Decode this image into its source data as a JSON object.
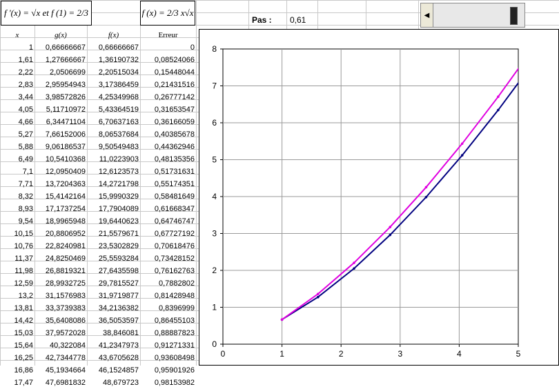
{
  "formulas": {
    "left": "f '(x) = √x  et  f (1) = 2/3",
    "right": "f (x) = 2/3 x√x"
  },
  "pas": {
    "label": "Pas :",
    "value": "0,61"
  },
  "table": {
    "headers": [
      "x",
      "g(x)",
      "f(x)",
      "Erreur"
    ],
    "rows": [
      [
        "1",
        "0,66666667",
        "0,66666667",
        "0"
      ],
      [
        "1,61",
        "1,27666667",
        "1,36190732",
        "0,08524066"
      ],
      [
        "2,22",
        "2,0506699",
        "2,20515034",
        "0,15448044"
      ],
      [
        "2,83",
        "2,95954943",
        "3,17386459",
        "0,21431516"
      ],
      [
        "3,44",
        "3,98572826",
        "4,25349968",
        "0,26777142"
      ],
      [
        "4,05",
        "5,11710972",
        "5,43364519",
        "0,31653547"
      ],
      [
        "4,66",
        "6,34471104",
        "6,70637163",
        "0,36166059"
      ],
      [
        "5,27",
        "7,66152006",
        "8,06537684",
        "0,40385678"
      ],
      [
        "5,88",
        "9,06186537",
        "9,50549483",
        "0,44362946"
      ],
      [
        "6,49",
        "10,5410368",
        "11,0223903",
        "0,48135356"
      ],
      [
        "7,1",
        "12,0950409",
        "12,6123573",
        "0,51731631"
      ],
      [
        "7,71",
        "13,7204363",
        "14,2721798",
        "0,55174351"
      ],
      [
        "8,32",
        "15,4142164",
        "15,9990329",
        "0,58481649"
      ],
      [
        "8,93",
        "17,1737254",
        "17,7904089",
        "0,61668347"
      ],
      [
        "9,54",
        "18,9965948",
        "19,6440623",
        "0,64746747"
      ],
      [
        "10,15",
        "20,8806952",
        "21,5579671",
        "0,67727192"
      ],
      [
        "10,76",
        "22,8240981",
        "23,5302829",
        "0,70618476"
      ],
      [
        "11,37",
        "24,8250469",
        "25,5593284",
        "0,73428152"
      ],
      [
        "11,98",
        "26,8819321",
        "27,6435598",
        "0,76162763"
      ],
      [
        "12,59",
        "28,9932725",
        "29,7815527",
        "0,7882802"
      ],
      [
        "13,2",
        "31,1576983",
        "31,9719877",
        "0,81428948"
      ],
      [
        "13,81",
        "33,3739383",
        "34,2136382",
        "0,8396999"
      ],
      [
        "14,42",
        "35,6408086",
        "36,5053597",
        "0,86455103"
      ],
      [
        "15,03",
        "37,9572028",
        "38,846081",
        "0,88887823"
      ],
      [
        "15,64",
        "40,322084",
        "41,2347973",
        "0,91271331"
      ],
      [
        "16,25",
        "42,7344778",
        "43,6705628",
        "0,93608498"
      ],
      [
        "16,86",
        "45,1934664",
        "46,1524857",
        "0,95901926"
      ],
      [
        "17,47",
        "47,6981832",
        "48,679723",
        "0,98153982"
      ]
    ]
  },
  "colors": {
    "series_g": "#000080",
    "series_f": "#e000e0"
  },
  "chart_data": {
    "type": "line",
    "xlim": [
      0,
      5
    ],
    "ylim": [
      0,
      8
    ],
    "xticks": [
      "0",
      "1",
      "2",
      "3",
      "4",
      "5"
    ],
    "yticks": [
      "0",
      "1",
      "2",
      "3",
      "4",
      "5",
      "6",
      "7",
      "8"
    ],
    "grid": true,
    "series": [
      {
        "x": [
          1,
          1.61,
          2.22,
          2.83,
          3.44,
          4.05,
          4.66,
          5.27
        ],
        "y": [
          0.66666667,
          1.27666667,
          2.0506699,
          2.95954943,
          3.98572826,
          5.11710972,
          6.34471104,
          7.66152006
        ]
      },
      {
        "x": [
          1,
          1.61,
          2.22,
          2.83,
          3.44,
          4.05,
          4.66,
          5.27
        ],
        "y": [
          0.66666667,
          1.36190732,
          2.20515034,
          3.17386459,
          4.25349968,
          5.43364519,
          6.70637163,
          8.06537684
        ]
      }
    ]
  }
}
